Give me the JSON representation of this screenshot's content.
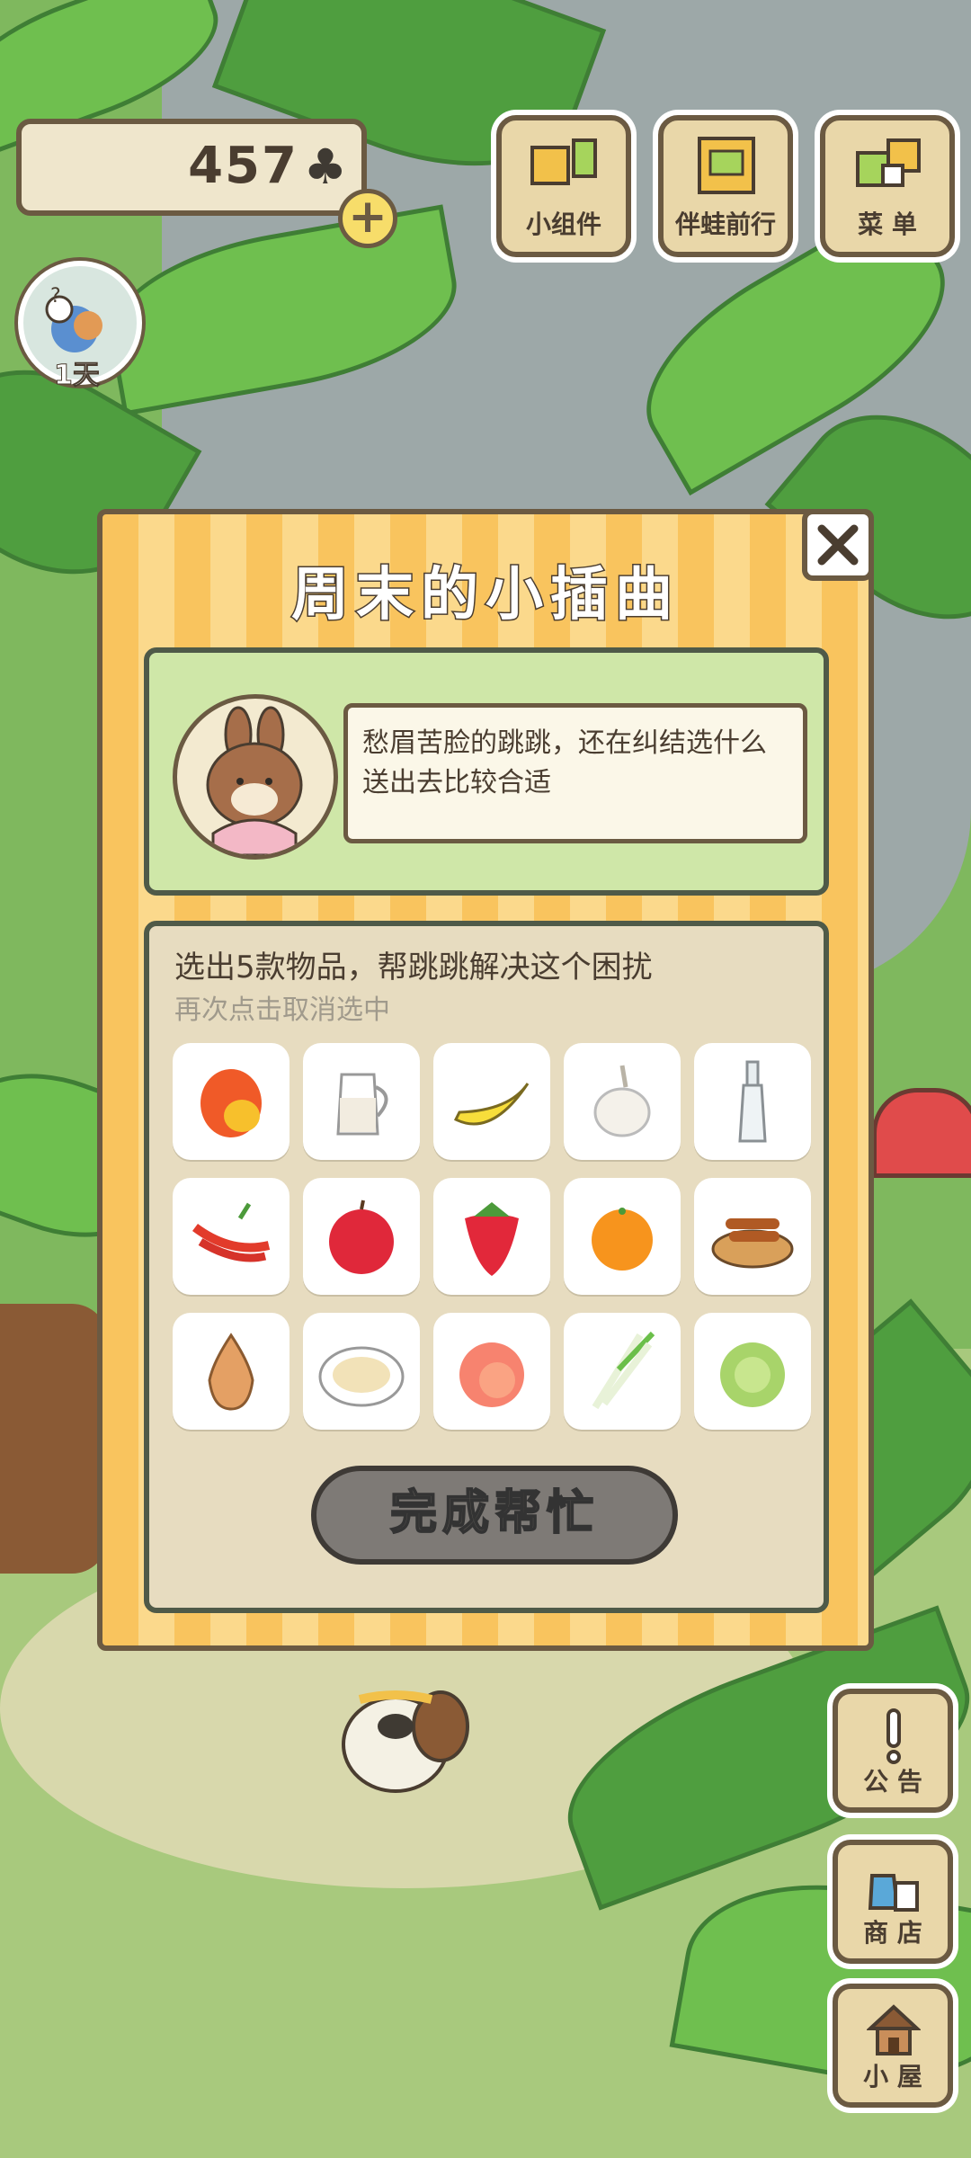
{
  "currency": {
    "amount": "457",
    "icon": "clover-icon"
  },
  "days": {
    "label": "1天"
  },
  "top_buttons": [
    {
      "label": "小组件",
      "icon": "widget-icon"
    },
    {
      "label": "伴蛙前行",
      "icon": "frog-journal-icon"
    },
    {
      "label": "菜 单",
      "icon": "menu-icon"
    }
  ],
  "side_buttons": [
    {
      "label": "公 告",
      "icon": "exclamation-icon"
    },
    {
      "label": "商 店",
      "icon": "shop-bag-icon"
    },
    {
      "label": "小 屋",
      "icon": "house-icon"
    }
  ],
  "dialog": {
    "title": "周末的小插曲",
    "story": "愁眉苦脸的跳跳，还在纠结选什么送出去比较合适",
    "instruction": "选出5款物品，帮跳跳解决这个困扰",
    "hint": "再次点击取消选中",
    "items": [
      {
        "name": "mango"
      },
      {
        "name": "milk-jug"
      },
      {
        "name": "banana"
      },
      {
        "name": "garlic"
      },
      {
        "name": "glass-bottle"
      },
      {
        "name": "chili-peppers"
      },
      {
        "name": "apple"
      },
      {
        "name": "strawberry"
      },
      {
        "name": "orange"
      },
      {
        "name": "fried-dough-plate"
      },
      {
        "name": "onion"
      },
      {
        "name": "dumpling-plate"
      },
      {
        "name": "peach"
      },
      {
        "name": "green-onion"
      },
      {
        "name": "cabbage"
      }
    ],
    "done_button": "完成帮忙"
  },
  "colors": {
    "dialog_stripe_a": "#f9c45e",
    "dialog_stripe_b": "#fbd98c",
    "story_panel": "#cfe7a8",
    "items_panel": "#e7dcc0",
    "done_button": "#7e7a76"
  }
}
